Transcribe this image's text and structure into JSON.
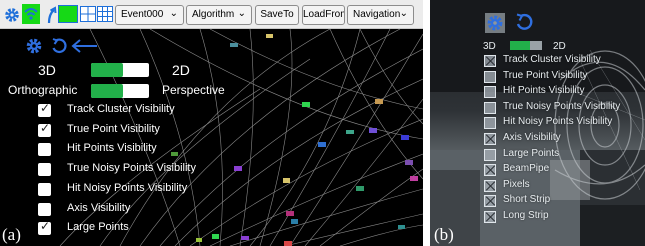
{
  "panel_a": {
    "tag": "(a)",
    "toolbar": {
      "icons": [
        "gear-icon",
        "wifi-icon",
        "arrow-up-icon",
        "single-view-icon",
        "quad-view-icon",
        "grid-view-icon"
      ],
      "event_select": "Event000",
      "algorithm_select": "Algorithm",
      "save_label": "SaveTo",
      "load_label": "LoadFrom",
      "navigation_select": "Navigation"
    },
    "view_toggle": {
      "left_label": "3D",
      "right_label": "2D",
      "value": 0.55
    },
    "projection_toggle": {
      "left_label": "Orthographic",
      "right_label": "Perspective",
      "value": 0.55
    },
    "checkboxes": [
      {
        "label": "Track Cluster Visibility",
        "checked": true
      },
      {
        "label": "True Point Visibility",
        "checked": true
      },
      {
        "label": "Hit Points Visibility",
        "checked": false
      },
      {
        "label": "True Noisy Points Visibility",
        "checked": false
      },
      {
        "label": "Hit Noisy Points Visibility",
        "checked": false
      },
      {
        "label": "Axis Visibility",
        "checked": false
      },
      {
        "label": "Large Points",
        "checked": true
      }
    ]
  },
  "panel_b": {
    "tag": "(b)",
    "view_toggle": {
      "left_label": "3D",
      "right_label": "2D"
    },
    "checkboxes": [
      {
        "label": "Track Cluster Visibility",
        "checked": true
      },
      {
        "label": "True Point Visibility",
        "checked": false
      },
      {
        "label": "Hit Points Visibility",
        "checked": false
      },
      {
        "label": "True Noisy Points Visibility",
        "checked": false
      },
      {
        "label": "Hit Noisy Points Visibility",
        "checked": false
      },
      {
        "label": "Axis Visibility",
        "checked": true
      },
      {
        "label": "Large Points",
        "checked": false
      },
      {
        "label": "BeamPipe",
        "checked": true
      },
      {
        "label": "Pixels",
        "checked": true
      },
      {
        "label": "Short Strip",
        "checked": true
      },
      {
        "label": "Long Strip",
        "checked": true
      }
    ]
  },
  "colors": {
    "accent_blue": "#1e6fd9",
    "toggle_green": "#22b04a",
    "highlight_green": "#16d916"
  }
}
